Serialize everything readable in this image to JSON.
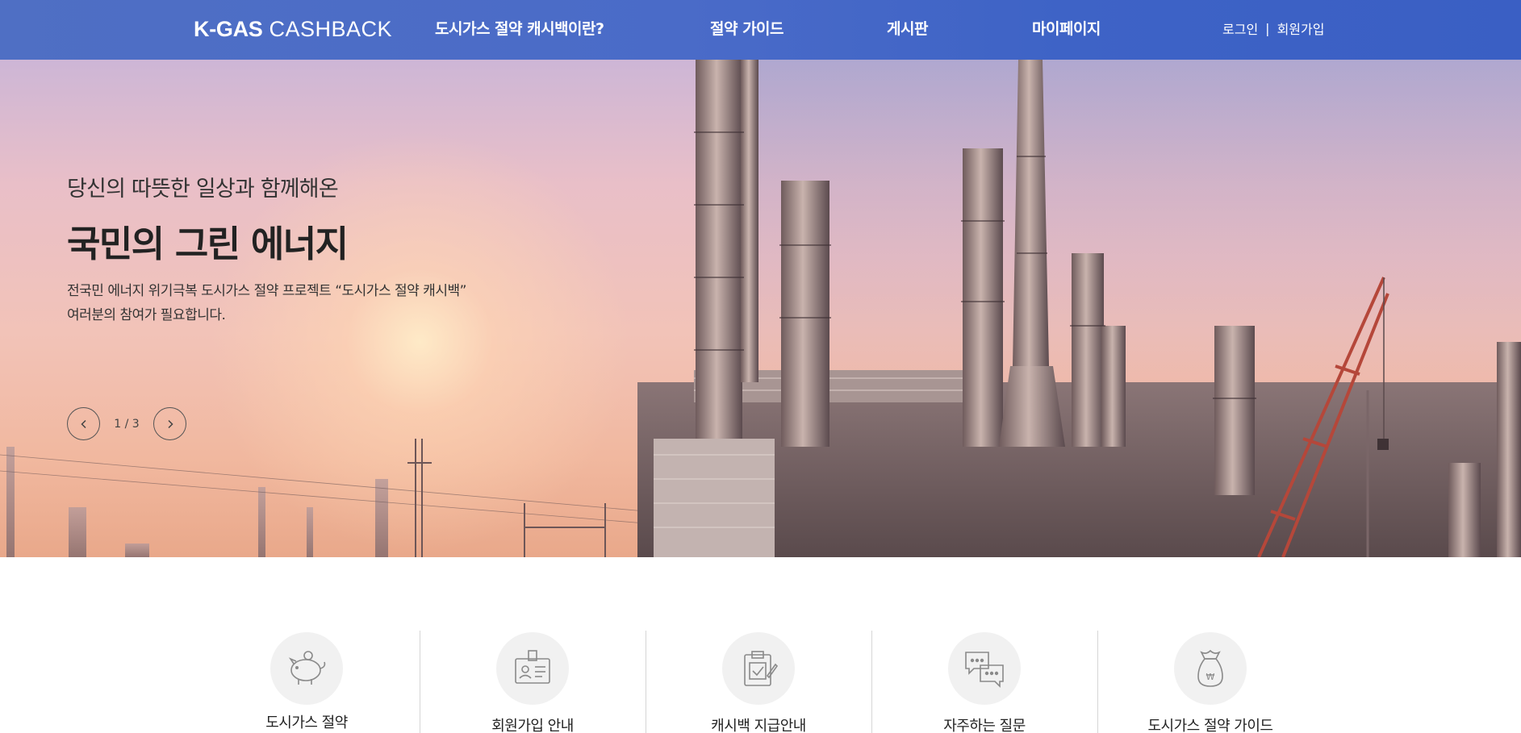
{
  "header": {
    "logo_strong": "K-GAS",
    "logo_light": "CASHBACK",
    "nav": [
      {
        "label": "도시가스 절약 캐시백이란?"
      },
      {
        "label": "절약 가이드"
      },
      {
        "label": "게시판"
      },
      {
        "label": "마이페이지"
      }
    ],
    "auth": {
      "login": "로그인",
      "separator": "|",
      "signup": "회원가입"
    }
  },
  "hero": {
    "subtitle": "당신의 따뜻한 일상과 함께해온",
    "title": "국민의 그린 에너지",
    "desc_line1": "전국민 에너지 위기극복 도시가스 절약 프로젝트 “도시가스 절약 캐시백”",
    "desc_line2": "여러분의 참여가 필요합니다.",
    "slider": {
      "prev_icon": "chevron-left-icon",
      "next_icon": "chevron-right-icon",
      "counter": "1 / 3"
    }
  },
  "services": [
    {
      "label": "도시가스 절약",
      "icon": "piggy-bank-icon"
    },
    {
      "label": "회원가입 안내",
      "icon": "id-card-icon"
    },
    {
      "label": "캐시백 지급안내",
      "icon": "clipboard-check-icon"
    },
    {
      "label": "자주하는 질문",
      "icon": "chat-bubbles-icon"
    },
    {
      "label": "도시가스 절약 가이드",
      "icon": "money-bag-icon"
    }
  ],
  "colors": {
    "header_bg": "#4a6bc8",
    "text_dark": "#222222",
    "icon_circle_bg": "#f1f1f1",
    "divider": "#d6d6d6"
  }
}
